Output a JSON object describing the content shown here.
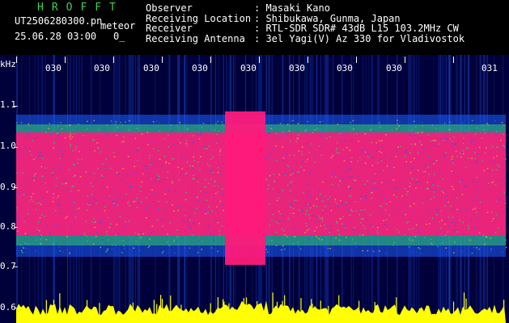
{
  "header": {
    "logo_text": "HROFFT",
    "filename": "UT2506280300.pn",
    "file_tag": "meteor",
    "datetime": "25.06.28 03:00",
    "fraction": "0_",
    "fields": [
      {
        "key": "Observer",
        "sep": ": ",
        "value": "Masaki Kano"
      },
      {
        "key": "Receiving Location",
        "sep": ": ",
        "value": "Shibukawa, Gunma, Japan"
      },
      {
        "key": "Receiver",
        "sep": ": ",
        "value": "RTL-SDR SDR# 43dB L15 103.2MHz CW"
      },
      {
        "key": "Receiving Antenna",
        "sep": ": ",
        "value": "3el Yagi(V) Az 330 for Vladivostok"
      }
    ]
  },
  "plot": {
    "y_unit": "kHz",
    "y_ticks": [
      "1.1",
      "1.0",
      "0.9",
      "0.8",
      "0.7",
      "0.6"
    ],
    "time_labels": [
      "030",
      "030",
      "030",
      "030",
      "030",
      "030",
      "030",
      "030",
      "031"
    ],
    "colors": {
      "background": "#00003a",
      "signal": "#ff1a7a",
      "noise_green": "#33cc66",
      "noise_blue": "#1e5cff",
      "spectrum": "#ffff00"
    }
  }
}
